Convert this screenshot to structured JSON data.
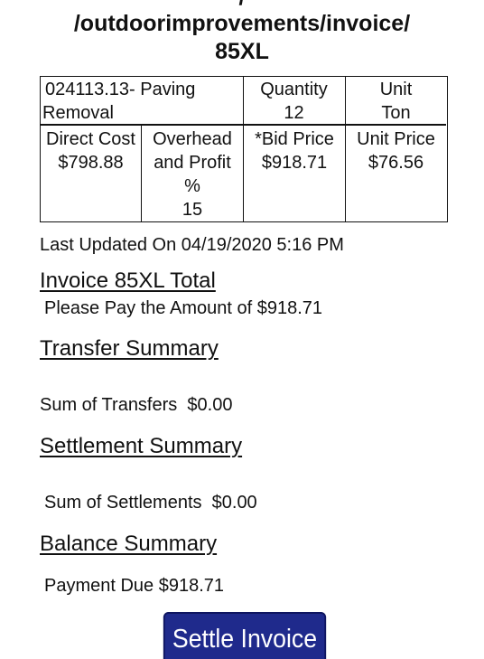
{
  "header": {
    "line1": "/",
    "line2": "/outdoorimprovements/invoice/",
    "line3": "85XL"
  },
  "item": {
    "code_label": "024113.13- Paving",
    "code_label_2": "Removal",
    "quantity_label": "Quantity",
    "quantity_value": "12",
    "unit_label": "Unit",
    "unit_value": "Ton",
    "direct_cost_label": "Direct Cost",
    "direct_cost_value": "$798.88",
    "overhead_label_1": "Overhead",
    "overhead_label_2": "and Profit",
    "overhead_label_3": "%",
    "overhead_value": "15",
    "bid_price_label": "*Bid Price",
    "bid_price_value": "$918.71",
    "unit_price_label": "Unit Price",
    "unit_price_value": "$76.56"
  },
  "last_updated": "Last Updated On 04/19/2020 5:16 PM",
  "invoice_total": {
    "heading": "Invoice 85XL Total",
    "text": "Please Pay the Amount of $918.71"
  },
  "transfer_summary": {
    "heading": "Transfer Summary",
    "text": "Sum of Transfers  $0.00"
  },
  "settlement_summary": {
    "heading": "Settlement Summary",
    "text": "Sum of Settlements  $0.00"
  },
  "balance_summary": {
    "heading": "Balance Summary",
    "text": "Payment Due $918.71"
  },
  "settle_button_label": "Settle Invoice",
  "colors": {
    "button_bg": "#1f2a8c",
    "text": "#111111"
  }
}
